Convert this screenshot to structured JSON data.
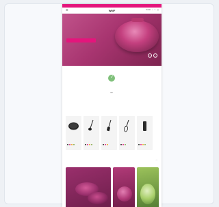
{
  "promo_bar": {
    "text": ""
  },
  "header": {
    "menu_icon": "menu-icon",
    "logo": "WMF",
    "account_label": "Konto",
    "icons": [
      "search-icon",
      "heart-icon",
      "cart-icon"
    ]
  },
  "hero": {
    "title": "",
    "subtitle": "",
    "cta_label": "",
    "arrows": [
      "‹",
      "›"
    ]
  },
  "service": {
    "icon": "check-badge-icon",
    "title": "",
    "text": ""
  },
  "section": {
    "title": "",
    "subtitle": "",
    "filters": ""
  },
  "products": [
    {
      "name": "",
      "price": "",
      "type": "pan"
    },
    {
      "name": "",
      "price": "",
      "type": "ladle"
    },
    {
      "name": "",
      "price": "",
      "type": "spatula"
    },
    {
      "name": "",
      "price": "",
      "type": "whisk"
    },
    {
      "name": "",
      "price": "",
      "type": "jar"
    }
  ],
  "carousel": {
    "label": "",
    "arrows": [
      "‹",
      "›"
    ]
  },
  "tiles": [
    {
      "title": "",
      "color": "#8b2a60"
    },
    {
      "title": "",
      "color": "#a33571"
    },
    {
      "title": "",
      "color": "#7fa84a"
    }
  ],
  "colors": {
    "brand": "#e4157c",
    "hero": "#a83570",
    "service_badge": "#7fc07a"
  }
}
